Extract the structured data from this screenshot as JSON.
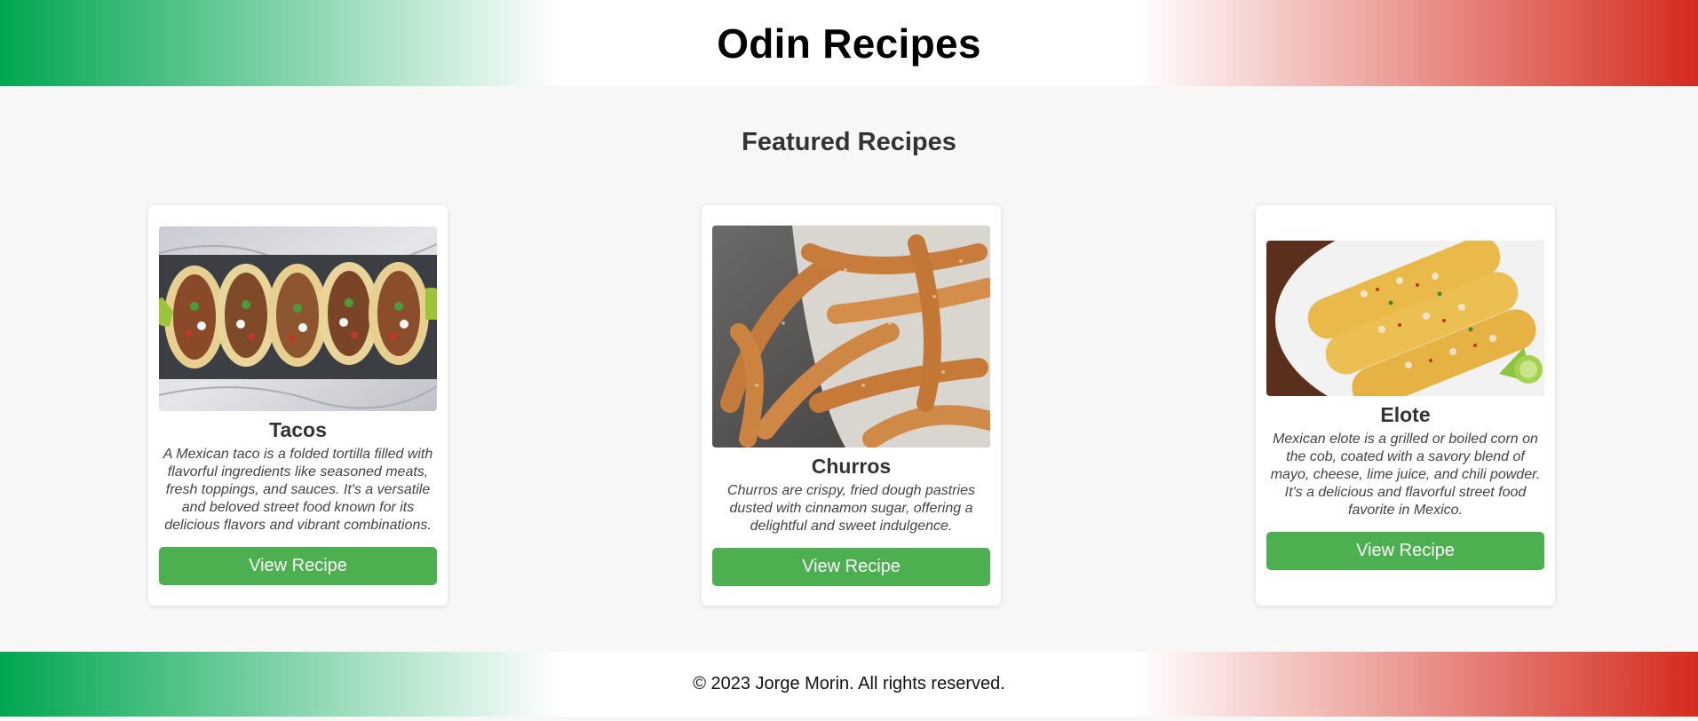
{
  "header": {
    "title": "Odin Recipes"
  },
  "main": {
    "section_title": "Featured Recipes",
    "recipes": [
      {
        "title": "Tacos",
        "image": "tacos-photo",
        "description": "A Mexican taco is a folded tortilla filled with flavorful ingredients like seasoned meats, fresh toppings, and sauces. It's a versatile and beloved street food known for its delicious flavors and vibrant combinations.",
        "button_label": "View Recipe"
      },
      {
        "title": "Churros",
        "image": "churros-photo",
        "description": "Churros are crispy, fried dough pastries dusted with cinnamon sugar, offering a delightful and sweet indulgence.",
        "button_label": "View Recipe"
      },
      {
        "title": "Elote",
        "image": "elote-photo",
        "description": "Mexican elote is a grilled or boiled corn on the cob, coated with a savory blend of mayo, cheese, lime juice, and chili powder. It's a delicious and flavorful street food favorite in Mexico.",
        "button_label": "View Recipe"
      }
    ]
  },
  "footer": {
    "copyright": "© 2023 Jorge Morin. All rights reserved."
  },
  "colors": {
    "green": "#00a651",
    "red": "#d52b1e",
    "button": "#4caf50",
    "background": "#f7f7f7"
  }
}
